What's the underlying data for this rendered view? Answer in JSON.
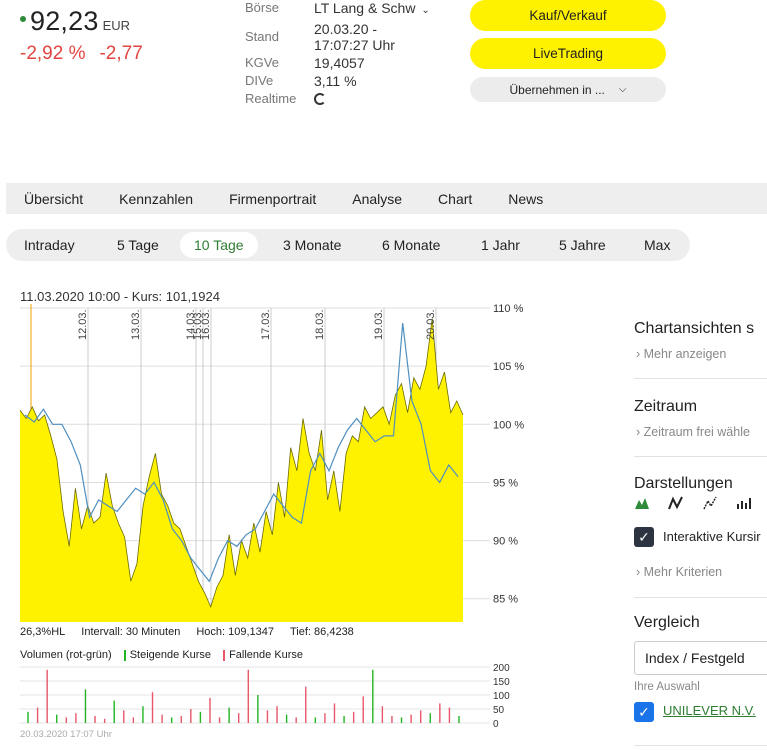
{
  "quote": {
    "price": "92,23",
    "currency": "EUR",
    "change_pct": "-2,92 %",
    "change_abs": "-2,77"
  },
  "keyinfo": {
    "exchange_label": "Börse",
    "exchange_value": "LT Lang & Schw",
    "date_label": "Stand",
    "date_value_1": "20.03.20 -",
    "date_value_2": "17:07:27 Uhr",
    "kgve_label": "KGVe",
    "kgve_value": "19,4057",
    "dive_label": "DIVe",
    "dive_value": "3,11 %",
    "realtime_label": "Realtime"
  },
  "buttons": {
    "buy_sell": "Kauf/Verkauf",
    "live_trading": "LiveTrading",
    "take_over": "Übernehmen in ..."
  },
  "main_tabs": [
    "Übersicht",
    "Kennzahlen",
    "Firmenportrait",
    "Analyse",
    "Chart",
    "News"
  ],
  "range_tabs": [
    "Intraday",
    "5 Tage",
    "10 Tage",
    "3 Monate",
    "6 Monate",
    "1 Jahr",
    "5 Jahre",
    "Max"
  ],
  "range_active_index": 2,
  "chart_info": "11.03.2020 10:00  -  Kurs: 101,1924",
  "stats": {
    "range": "26,3%HL",
    "interval": "Intervall: 30 Minuten",
    "high": "Hoch: 109,1347",
    "low": "Tief: 86,4238"
  },
  "volume_legend": {
    "label": "Volumen (rot-grün)",
    "rising": "Steigende Kurse",
    "falling": "Fallende Kurse"
  },
  "volume_footer": "20.03.2020 17:07 Uhr",
  "side": {
    "views_title": "Chartansichten s",
    "more_show": "Mehr anzeigen",
    "period_title": "Zeitraum",
    "period_link": "Zeitraum frei wähle",
    "display_title": "Darstellungen",
    "interactive_label": "Interaktive Kursir",
    "more_criteria": "Mehr Kriterien",
    "compare_title": "Vergleich",
    "compare_select": "Index / Festgeld",
    "your_choice": "Ihre Auswahl",
    "choice_item": "UNILEVER N.V."
  },
  "colors": {
    "accent_yellow": "#fff200",
    "positive_green": "#2e8b3a",
    "negative_red": "#e2443f",
    "checkbox_dark": "#2b3440",
    "checkbox_blue": "#1a73e8"
  },
  "chart_data": {
    "type": "area",
    "y_tick_labels": [
      "110 %",
      "105 %",
      "100 %",
      "95 %",
      "90 %",
      "85 %"
    ],
    "ylim": [
      83,
      110
    ],
    "x_tick_labels": [
      "12.03.",
      "13.03.",
      "14.03.",
      "15.03.",
      "16.03.",
      "17.03.",
      "18.03.",
      "19.03.",
      "20.03."
    ],
    "price_series": [
      101.2,
      100.5,
      101.5,
      100.3,
      100.8,
      99.0,
      97.0,
      92.5,
      89.5,
      94.5,
      91.0,
      93.0,
      91.5,
      92.0,
      95.8,
      93.0,
      91.5,
      90.3,
      86.5,
      88.0,
      93.0,
      95.5,
      97.5,
      94.0,
      93.0,
      91.5,
      91.0,
      89.5,
      88.0,
      86.5,
      85.5,
      84.3,
      86.0,
      87.0,
      90.5,
      87.0,
      90.0,
      88.5,
      91.5,
      89.0,
      92.5,
      90.5,
      95.0,
      92.0,
      98.0,
      96.0,
      100.5,
      97.5,
      96.0,
      99.5,
      93.5,
      96.0,
      92.5,
      97.5,
      99.0,
      98.5,
      101.5,
      100.5,
      101.0,
      101.5,
      100.0,
      102.5,
      103.5,
      101.0,
      104.0,
      103.0,
      105.0,
      109.1,
      103.0,
      104.5,
      101.0,
      102.0,
      100.8
    ],
    "compare_series": [
      100.8,
      100.2,
      101.3,
      100.0,
      100.0,
      98.5,
      96.5,
      92.0,
      93.5,
      93.0,
      92.5,
      93.5,
      94.5,
      94.0,
      95.0,
      93.5,
      91.0,
      90.0,
      88.5,
      87.5,
      86.5,
      88.5,
      90.0,
      89.5,
      90.5,
      91.0,
      92.5,
      94.0,
      93.0,
      92.0,
      91.5,
      96.0,
      97.5,
      96.0,
      98.0,
      99.5,
      100.5,
      99.5,
      98.5,
      99.0,
      99.0,
      108.7,
      102.0,
      100.0,
      96.0,
      95.0,
      96.5,
      95.5
    ],
    "volume_values": [
      40,
      55,
      190,
      30,
      20,
      35,
      120,
      25,
      15,
      80,
      45,
      20,
      60,
      110,
      30,
      20,
      25,
      50,
      40,
      90,
      20,
      55,
      35,
      190,
      100,
      45,
      60,
      30,
      20,
      130,
      20,
      35,
      70,
      25,
      40,
      95,
      190,
      60,
      25,
      20,
      30,
      45,
      35,
      70,
      55,
      25
    ],
    "volume_y_tick_labels": [
      "200",
      "150",
      "100",
      "50",
      "0"
    ],
    "stats": {
      "high": 109.1347,
      "low": 86.4238
    }
  }
}
